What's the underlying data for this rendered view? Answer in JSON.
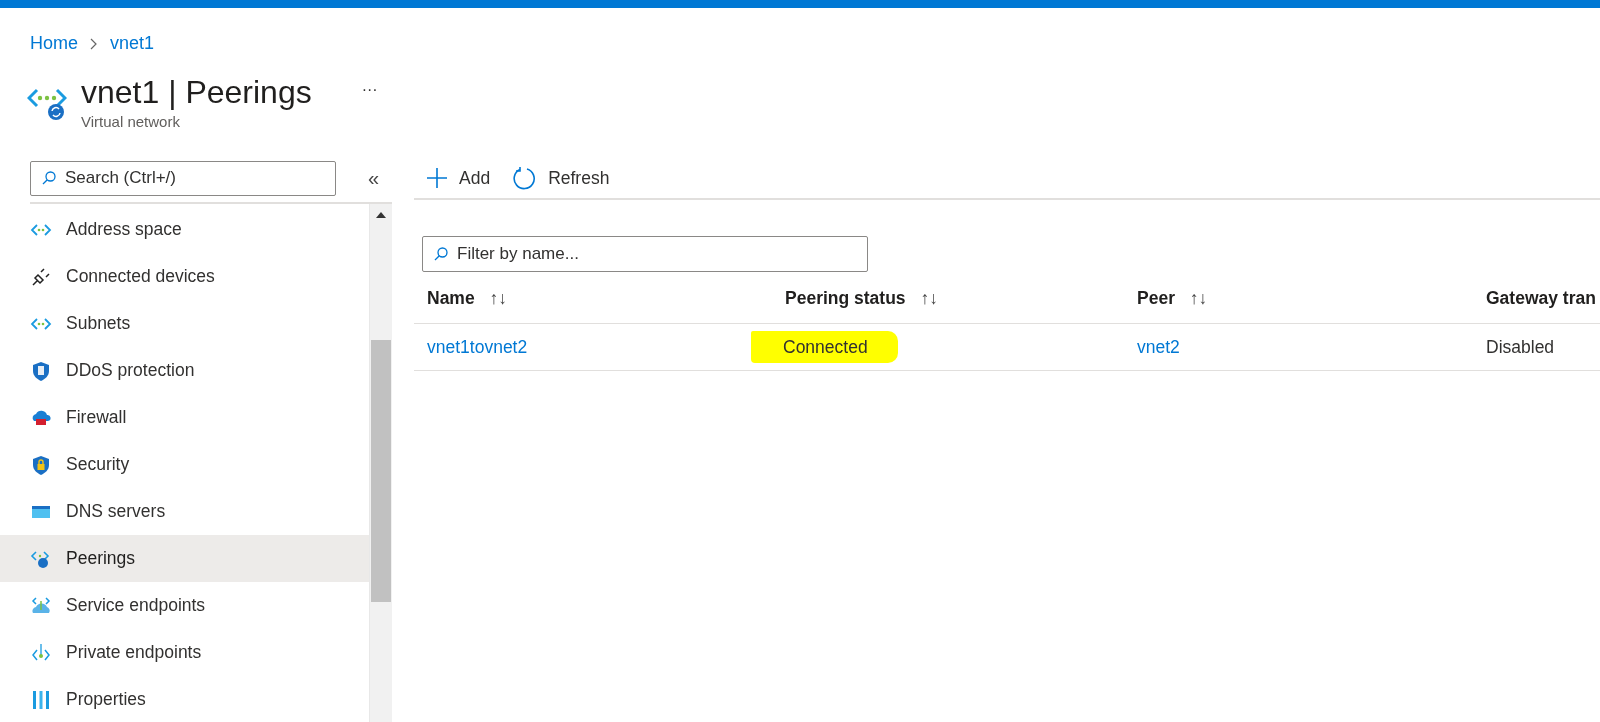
{
  "breadcrumb": [
    "Home",
    "vnet1"
  ],
  "header": {
    "resource": "vnet1",
    "separator": "|",
    "page": "Peerings",
    "subtitle": "Virtual network",
    "more": "···"
  },
  "sidebar": {
    "search": {
      "placeholder": "Search (Ctrl+/)"
    },
    "collapse": "«",
    "items": [
      {
        "label": "Address space",
        "selected": false
      },
      {
        "label": "Connected devices",
        "selected": false
      },
      {
        "label": "Subnets",
        "selected": false
      },
      {
        "label": "DDoS protection",
        "selected": false
      },
      {
        "label": "Firewall",
        "selected": false
      },
      {
        "label": "Security",
        "selected": false
      },
      {
        "label": "DNS servers",
        "selected": false
      },
      {
        "label": "Peerings",
        "selected": true
      },
      {
        "label": "Service endpoints",
        "selected": false
      },
      {
        "label": "Private endpoints",
        "selected": false
      },
      {
        "label": "Properties",
        "selected": false
      }
    ]
  },
  "toolbar": [
    {
      "kind": "add",
      "label": "Add"
    },
    {
      "kind": "refresh",
      "label": "Refresh"
    }
  ],
  "filter": {
    "placeholder": "Filter by name..."
  },
  "table": {
    "columns": [
      {
        "label": "Name",
        "sort": "↑↓"
      },
      {
        "label": "Peering status",
        "sort": "↑↓"
      },
      {
        "label": "Peer",
        "sort": "↑↓"
      },
      {
        "label": "Gateway tran"
      }
    ],
    "rows": [
      [
        {
          "text": "vnet1tovnet2",
          "kind": "link"
        },
        {
          "text": "Connected",
          "kind": "text",
          "highlighted": true
        },
        {
          "text": "vnet2",
          "kind": "link"
        },
        {
          "text": "Disabled",
          "kind": "text"
        }
      ]
    ]
  }
}
